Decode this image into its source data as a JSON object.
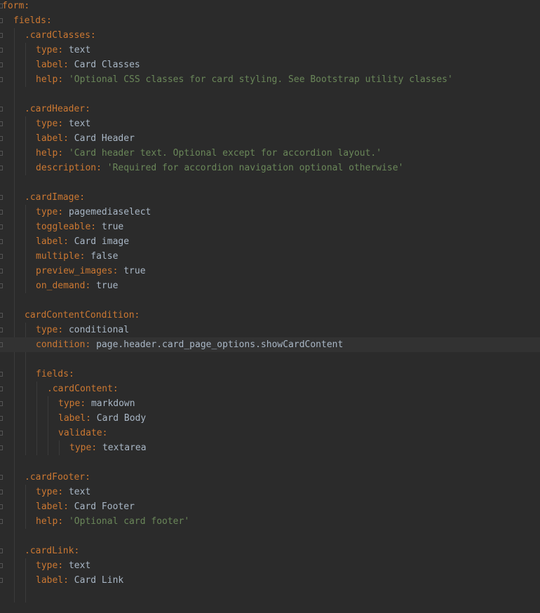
{
  "editor": {
    "lines": [
      {
        "indent": 0,
        "key": "form",
        "value": "",
        "kind": "plain"
      },
      {
        "indent": 1,
        "key": "fields",
        "value": "",
        "kind": "plain"
      },
      {
        "indent": 2,
        "key": ".cardClasses",
        "value": "",
        "kind": "plain"
      },
      {
        "indent": 3,
        "key": "type",
        "value": "text",
        "kind": "plain"
      },
      {
        "indent": 3,
        "key": "label",
        "value": "Card Classes",
        "kind": "plain"
      },
      {
        "indent": 3,
        "key": "help",
        "value": "'Optional CSS classes for card styling. See Bootstrap utility classes'",
        "kind": "string"
      },
      {
        "indent": 0,
        "key": "",
        "value": "",
        "kind": "blank"
      },
      {
        "indent": 2,
        "key": ".cardHeader",
        "value": "",
        "kind": "plain"
      },
      {
        "indent": 3,
        "key": "type",
        "value": "text",
        "kind": "plain"
      },
      {
        "indent": 3,
        "key": "label",
        "value": "Card Header",
        "kind": "plain"
      },
      {
        "indent": 3,
        "key": "help",
        "value": "'Card header text. Optional except for accordion layout.'",
        "kind": "string"
      },
      {
        "indent": 3,
        "key": "description",
        "value": "'Required for accordion navigation optional otherwise'",
        "kind": "string"
      },
      {
        "indent": 0,
        "key": "",
        "value": "",
        "kind": "blank"
      },
      {
        "indent": 2,
        "key": ".cardImage",
        "value": "",
        "kind": "plain"
      },
      {
        "indent": 3,
        "key": "type",
        "value": "pagemediaselect",
        "kind": "plain"
      },
      {
        "indent": 3,
        "key": "toggleable",
        "value": "true",
        "kind": "plain"
      },
      {
        "indent": 3,
        "key": "label",
        "value": "Card image",
        "kind": "plain"
      },
      {
        "indent": 3,
        "key": "multiple",
        "value": "false",
        "kind": "plain"
      },
      {
        "indent": 3,
        "key": "preview_images",
        "value": "true",
        "kind": "plain"
      },
      {
        "indent": 3,
        "key": "on_demand",
        "value": "true",
        "kind": "plain"
      },
      {
        "indent": 0,
        "key": "",
        "value": "",
        "kind": "blank"
      },
      {
        "indent": 2,
        "key": "cardContentCondition",
        "value": "",
        "kind": "plain"
      },
      {
        "indent": 3,
        "key": "type",
        "value": "conditional",
        "kind": "plain"
      },
      {
        "indent": 3,
        "key": "condition",
        "value": "page.header.card_page_options.showCardContent",
        "kind": "plain",
        "current": true
      },
      {
        "indent": 0,
        "key": "",
        "value": "",
        "kind": "blank"
      },
      {
        "indent": 3,
        "key": "fields",
        "value": "",
        "kind": "plain"
      },
      {
        "indent": 4,
        "key": ".cardContent",
        "value": "",
        "kind": "plain"
      },
      {
        "indent": 5,
        "key": "type",
        "value": "markdown",
        "kind": "plain"
      },
      {
        "indent": 5,
        "key": "label",
        "value": "Card Body",
        "kind": "plain"
      },
      {
        "indent": 5,
        "key": "validate",
        "value": "",
        "kind": "plain"
      },
      {
        "indent": 6,
        "key": "type",
        "value": "textarea",
        "kind": "plain"
      },
      {
        "indent": 0,
        "key": "",
        "value": "",
        "kind": "blank"
      },
      {
        "indent": 2,
        "key": ".cardFooter",
        "value": "",
        "kind": "plain"
      },
      {
        "indent": 3,
        "key": "type",
        "value": "text",
        "kind": "plain"
      },
      {
        "indent": 3,
        "key": "label",
        "value": "Card Footer",
        "kind": "plain"
      },
      {
        "indent": 3,
        "key": "help",
        "value": "'Optional card footer'",
        "kind": "string"
      },
      {
        "indent": 0,
        "key": "",
        "value": "",
        "kind": "blank"
      },
      {
        "indent": 2,
        "key": ".cardLink",
        "value": "",
        "kind": "plain"
      },
      {
        "indent": 3,
        "key": "type",
        "value": "text",
        "kind": "plain"
      },
      {
        "indent": 3,
        "key": "label",
        "value": "Card Link",
        "kind": "plain"
      }
    ]
  },
  "colors": {
    "background": "#2b2b2b",
    "key": "#cc7832",
    "value": "#a9b7c6",
    "string": "#6a8759",
    "current_line": "#323232"
  }
}
